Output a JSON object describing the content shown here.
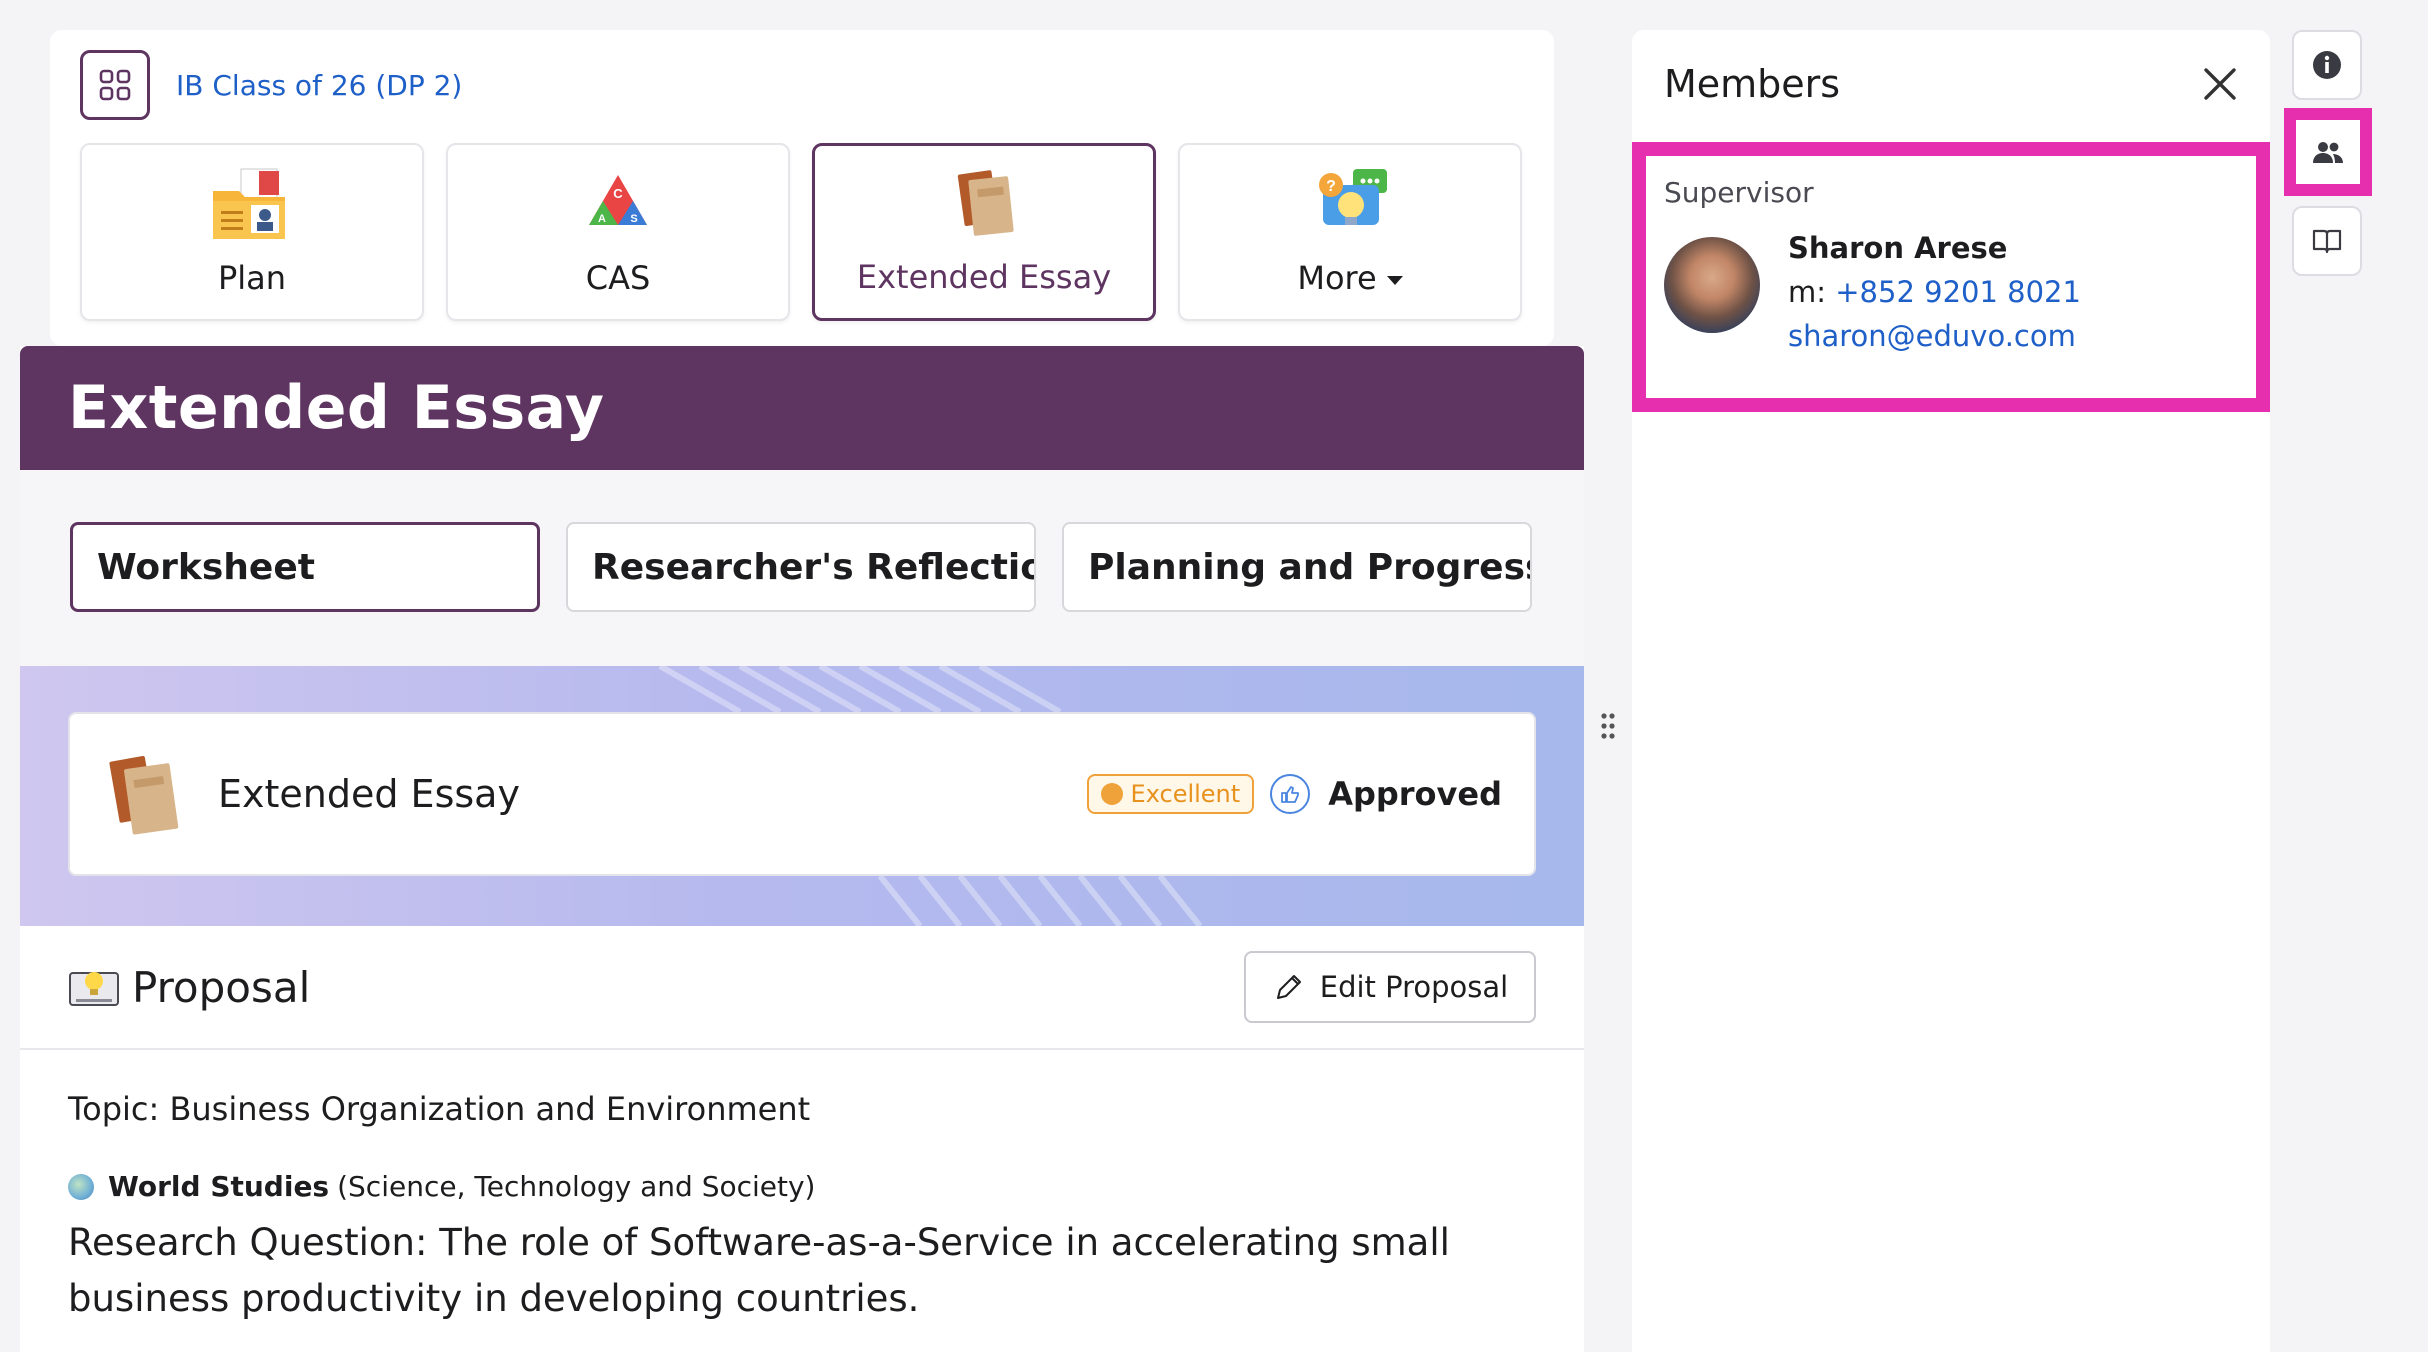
{
  "class_name": "IB Class of 26 (DP 2)",
  "apps": [
    {
      "label": "Plan",
      "icon": "plan-folder-icon"
    },
    {
      "label": "CAS",
      "icon": "cas-triangle-icon"
    },
    {
      "label": "Extended Essay",
      "icon": "extended-essay-book-icon"
    },
    {
      "label": "More",
      "icon": "more-chat-bulb-icon"
    }
  ],
  "banner": {
    "title": "Extended Essay"
  },
  "tabs": [
    {
      "label": "Worksheet"
    },
    {
      "label": "Researcher's Reflection ..."
    },
    {
      "label": "Planning and Progress ..."
    }
  ],
  "ee_card": {
    "title": "Extended Essay",
    "grade_badge": "Excellent",
    "status": "Approved"
  },
  "proposal": {
    "title": "Proposal",
    "edit_label": "Edit Proposal",
    "topic": "Topic: Business Organization and Environment",
    "subject_name": "World Studies",
    "subject_detail": "(Science, Technology and Society)",
    "research_question": "Research Question: The role of Software-as-a-Service in accelerating small business productivity in developing countries."
  },
  "members": {
    "title": "Members",
    "role_label": "Supervisor",
    "name": "Sharon Arese",
    "phone_prefix": "m: ",
    "phone": "+852 9201 8021",
    "email": "sharon@eduvo.com"
  },
  "colors": {
    "brand": "#5e3460",
    "link": "#1e5fc8",
    "highlight": "#e62fae",
    "badge": "#f0a23a"
  }
}
